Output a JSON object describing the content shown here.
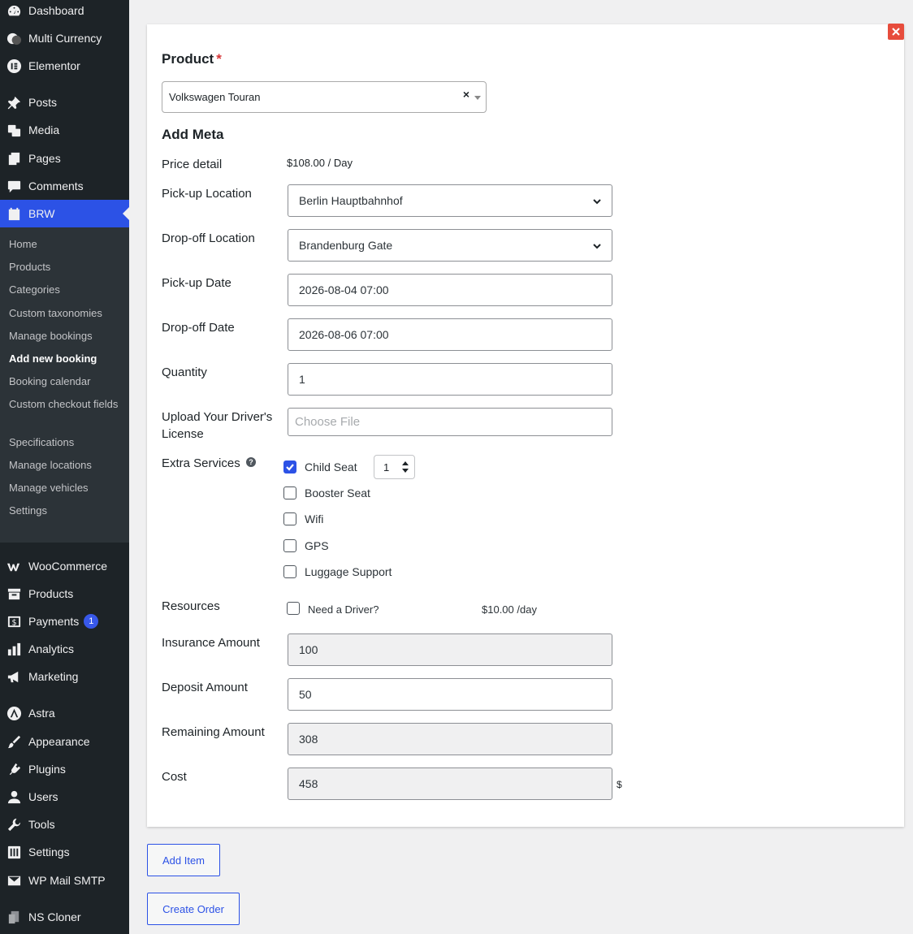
{
  "sidebar": {
    "top_items": [
      {
        "label": "Dashboard",
        "icon": "dashboard-icon"
      },
      {
        "label": "Multi Currency",
        "icon": "currency-icon"
      },
      {
        "label": "Elementor",
        "icon": "elementor-icon"
      },
      {
        "label": "Posts",
        "icon": "pin-icon"
      },
      {
        "label": "Media",
        "icon": "media-icon"
      },
      {
        "label": "Pages",
        "icon": "pages-icon"
      },
      {
        "label": "Comments",
        "icon": "comment-icon"
      },
      {
        "label": "BRW",
        "icon": "calendar-icon"
      }
    ],
    "submenu": [
      "Home",
      "Products",
      "Categories",
      "Custom taxonomies",
      "Manage bookings",
      "Add new booking",
      "Booking calendar",
      "Custom checkout fields",
      "Specifications",
      "Manage locations",
      "Manage vehicles",
      "Settings"
    ],
    "bottom_items": [
      {
        "label": "WooCommerce",
        "icon": "woo-icon"
      },
      {
        "label": "Products",
        "icon": "archive-icon"
      },
      {
        "label": "Payments",
        "icon": "payments-icon",
        "badge": "1"
      },
      {
        "label": "Analytics",
        "icon": "analytics-icon"
      },
      {
        "label": "Marketing",
        "icon": "megaphone-icon"
      },
      {
        "label": "Astra",
        "icon": "astra-icon"
      },
      {
        "label": "Appearance",
        "icon": "brush-icon"
      },
      {
        "label": "Plugins",
        "icon": "plugin-icon"
      },
      {
        "label": "Users",
        "icon": "user-icon"
      },
      {
        "label": "Tools",
        "icon": "wrench-icon"
      },
      {
        "label": "Settings",
        "icon": "settings-icon"
      },
      {
        "label": "WP Mail SMTP",
        "icon": "mail-icon"
      },
      {
        "label": "NS Cloner",
        "icon": "cloner-icon"
      }
    ]
  },
  "form": {
    "product_label": "Product",
    "required_mark": "*",
    "product_value": "Volkswagen Touran",
    "clear_mark": "×",
    "add_meta": "Add Meta",
    "price_detail_label": "Price detail",
    "price_detail_value": "$108.00 / Day",
    "pickup_location_label": "Pick-up Location",
    "pickup_location_value": "Berlin Hauptbahnhof",
    "dropoff_location_label": "Drop-off Location",
    "dropoff_location_value": "Brandenburg Gate",
    "pickup_date_label": "Pick-up Date",
    "pickup_date_value": "2026-08-04 07:00",
    "dropoff_date_label": "Drop-off Date",
    "dropoff_date_value": "2026-08-06 07:00",
    "quantity_label": "Quantity",
    "quantity_value": "1",
    "license_label": "Upload Your Driver's License",
    "license_placeholder": "Choose File",
    "extra_services_label": "Extra Services",
    "help_mark": "?",
    "extra_services": [
      {
        "label": "Child Seat",
        "checked": true
      },
      {
        "label": "Booster Seat",
        "checked": false
      },
      {
        "label": "Wifi",
        "checked": false
      },
      {
        "label": "GPS",
        "checked": false
      },
      {
        "label": "Luggage Support",
        "checked": false
      }
    ],
    "child_seat_qty": "1",
    "resources_label": "Resources",
    "resource_name": "Need a Driver?",
    "resource_price": "$10.00 /day",
    "insurance_label": "Insurance Amount",
    "insurance_value": "100",
    "deposit_label": "Deposit Amount",
    "deposit_value": "50",
    "remaining_label": "Remaining Amount",
    "remaining_value": "308",
    "cost_label": "Cost",
    "cost_value": "458",
    "currency_symbol": "$"
  },
  "actions": {
    "add_item": "Add Item",
    "create_order": "Create Order"
  },
  "colors": {
    "sidebar_bg": "#1d2327",
    "accent": "#2c52e6",
    "close": "#e74c3c"
  }
}
